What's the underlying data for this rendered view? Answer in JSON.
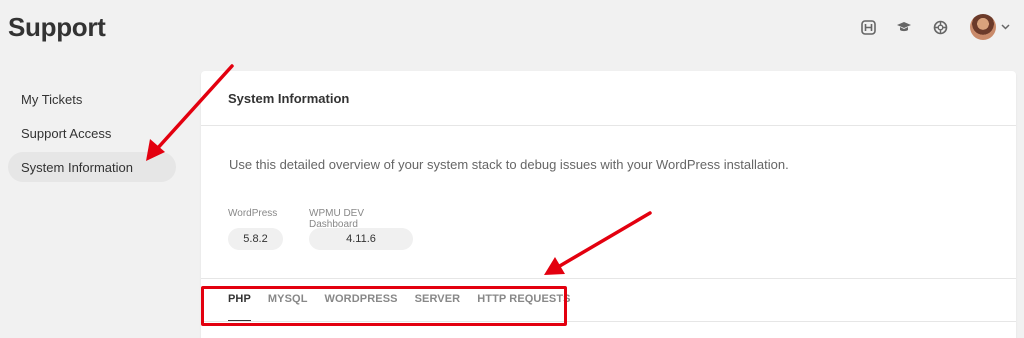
{
  "page": {
    "title": "Support"
  },
  "topbar": {
    "icons": [
      "hub-icon",
      "academy-icon",
      "support-lifebuoy-icon"
    ],
    "avatar": "avatar"
  },
  "sidebar": {
    "items": [
      {
        "label": "My Tickets",
        "active": false
      },
      {
        "label": "Support Access",
        "active": false
      },
      {
        "label": "System Information",
        "active": true
      }
    ]
  },
  "panel": {
    "title": "System Information",
    "description": "Use this detailed overview of your system stack to debug issues with your WordPress installation.",
    "versions": [
      {
        "label": "WordPress",
        "value": "5.8.2"
      },
      {
        "label": "WPMU DEV Dashboard",
        "value": "4.11.6"
      }
    ],
    "tabs": [
      {
        "label": "PHP",
        "active": true
      },
      {
        "label": "MYSQL",
        "active": false
      },
      {
        "label": "WORDPRESS",
        "active": false
      },
      {
        "label": "SERVER",
        "active": false
      },
      {
        "label": "HTTP REQUESTS",
        "active": false
      }
    ]
  },
  "colors": {
    "background": "#f1f1f1",
    "panel": "#ffffff",
    "annotation": "#e3000f",
    "text": "#333333"
  }
}
